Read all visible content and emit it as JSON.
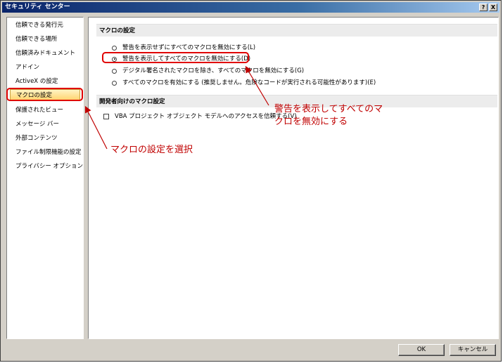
{
  "window": {
    "title": "セキュリティ センター",
    "help_button": "?",
    "close_button": "X"
  },
  "sidebar": {
    "items": [
      {
        "label": "信頼できる発行元",
        "selected": false
      },
      {
        "label": "信頼できる場所",
        "selected": false
      },
      {
        "label": "信頼済みドキュメント",
        "selected": false
      },
      {
        "label": "アドイン",
        "selected": false
      },
      {
        "label": "ActiveX の設定",
        "selected": false
      },
      {
        "label": "マクロの設定",
        "selected": true
      },
      {
        "label": "保護されたビュー",
        "selected": false
      },
      {
        "label": "メッセージ バー",
        "selected": false
      },
      {
        "label": "外部コンテンツ",
        "selected": false
      },
      {
        "label": "ファイル制限機能の設定",
        "selected": false
      },
      {
        "label": "プライバシー オプション",
        "selected": false
      }
    ]
  },
  "macro_settings": {
    "header": "マクロの設定",
    "options": [
      {
        "label": "警告を表示せずにすべてのマクロを無効にする(L)",
        "checked": false
      },
      {
        "label": "警告を表示してすべてのマクロを無効にする(D)",
        "checked": true
      },
      {
        "label": "デジタル署名されたマクロを除き、すべてのマクロを無効にする(G)",
        "checked": false
      },
      {
        "label": "すべてのマクロを有効にする (推奨しません。危険なコードが実行される可能性があります)(E)",
        "checked": false
      }
    ]
  },
  "developer_settings": {
    "header": "開発者向けのマクロ設定",
    "vba_checkbox": {
      "label": "VBA プロジェクト オブジェクト モデルへのアクセスを信頼する(V)",
      "checked": false
    }
  },
  "buttons": {
    "ok": "OK",
    "cancel": "キャンセル"
  },
  "annotations": {
    "select_macro": "マクロの設定を選択",
    "disable_line1": "警告を表示してすべてのマ",
    "disable_line2": "クロを無効にする",
    "color": "#c00000"
  }
}
